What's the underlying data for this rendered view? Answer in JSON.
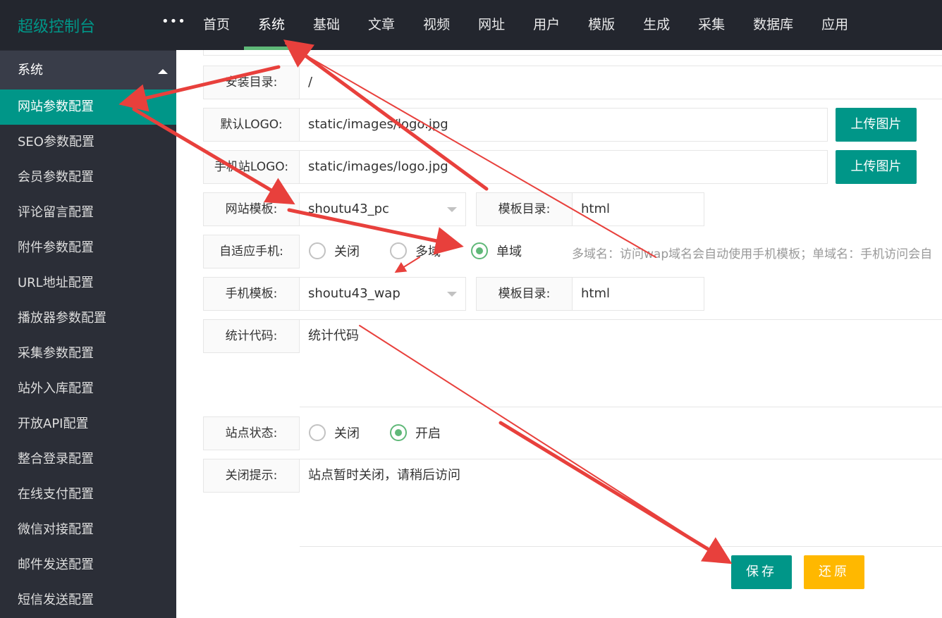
{
  "app_title": "超级控制台",
  "more_menu": "•••",
  "nav": [
    "首页",
    "系统",
    "基础",
    "文章",
    "视频",
    "网址",
    "用户",
    "模版",
    "生成",
    "采集",
    "数据库",
    "应用"
  ],
  "nav_active_index": 1,
  "sidebar": {
    "section": "系统",
    "items": [
      "网站参数配置",
      "SEO参数配置",
      "会员参数配置",
      "评论留言配置",
      "附件参数配置",
      "URL地址配置",
      "播放器参数配置",
      "采集参数配置",
      "站外入库配置",
      "开放API配置",
      "整合登录配置",
      "在线支付配置",
      "微信对接配置",
      "邮件发送配置",
      "短信发送配置"
    ],
    "active_index": 0
  },
  "form": {
    "install_dir": {
      "label": "安装目录:",
      "value": "/"
    },
    "default_logo": {
      "label": "默认LOGO:",
      "value": "static/images/logo.jpg",
      "button": "上传图片"
    },
    "mobile_logo": {
      "label": "手机站LOGO:",
      "value": "static/images/logo.jpg",
      "button": "上传图片"
    },
    "site_template": {
      "label": "网站模板:",
      "value": "shoutu43_pc",
      "dir_label": "模板目录:",
      "dir_value": "html"
    },
    "adaptive_mobile": {
      "label": "自适应手机:",
      "options": [
        "关闭",
        "多域",
        "单域"
      ],
      "selected_index": 2,
      "hint": "多域名：访问wap域名会自动使用手机模板；单域名：手机访问会自"
    },
    "mobile_template": {
      "label": "手机模板:",
      "value": "shoutu43_wap",
      "dir_label": "模板目录:",
      "dir_value": "html"
    },
    "stats_code": {
      "label": "统计代码:",
      "value": "统计代码"
    },
    "site_status": {
      "label": "站点状态:",
      "options": [
        "关闭",
        "开启"
      ],
      "selected_index": 1
    },
    "close_notice": {
      "label": "关闭提示:",
      "value": "站点暂时关闭，请稍后访问"
    }
  },
  "actions": {
    "save": "保存",
    "reset": "还原"
  },
  "colors": {
    "accent": "#009688",
    "nav_bg": "#23262e",
    "sidebar_bg": "#393d49",
    "radio_checked": "#5fb878",
    "reset": "#ffb800",
    "annotation": "#e8403c"
  }
}
